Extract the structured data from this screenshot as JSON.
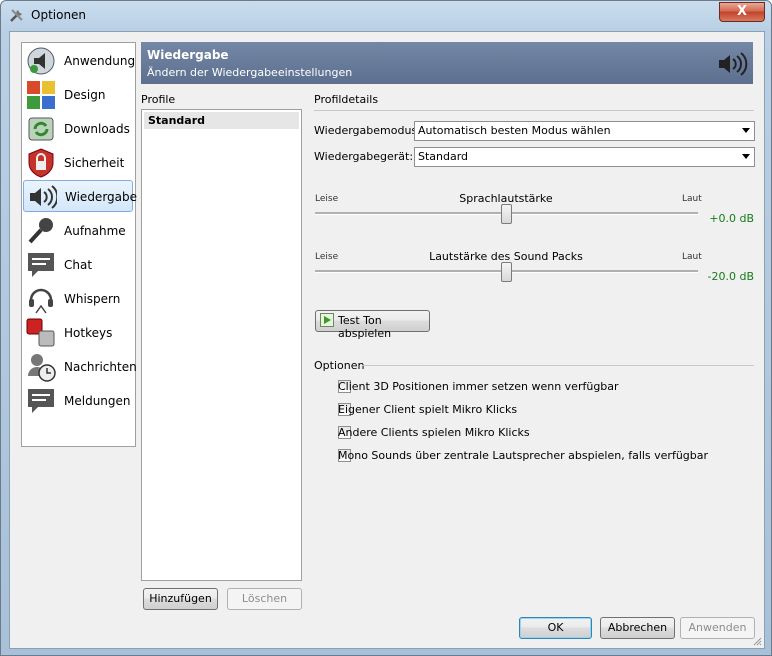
{
  "window": {
    "title": "Optionen",
    "close_label": "X"
  },
  "sidebar": {
    "items": [
      {
        "label": "Anwendung",
        "icon": "speaker-app-icon"
      },
      {
        "label": "Design",
        "icon": "design-tiles-icon"
      },
      {
        "label": "Downloads",
        "icon": "downloads-icon"
      },
      {
        "label": "Sicherheit",
        "icon": "shield-lock-icon"
      },
      {
        "label": "Wiedergabe",
        "icon": "speaker-waves-icon",
        "selected": true
      },
      {
        "label": "Aufnahme",
        "icon": "microphone-icon"
      },
      {
        "label": "Chat",
        "icon": "chat-icon"
      },
      {
        "label": "Whispern",
        "icon": "headset-icon"
      },
      {
        "label": "Hotkeys",
        "icon": "hotkeys-icon"
      },
      {
        "label": "Nachrichten",
        "icon": "messages-icon"
      },
      {
        "label": "Meldungen",
        "icon": "notifications-icon"
      }
    ]
  },
  "header": {
    "title": "Wiedergabe",
    "subtitle": "Ändern der Wiedergabeeinstellungen"
  },
  "profiles": {
    "label": "Profile",
    "items": [
      "Standard"
    ],
    "add_label": "Hinzufügen",
    "delete_label": "Löschen"
  },
  "details": {
    "label": "Profildetails",
    "mode_label": "Wiedergabemodus:",
    "mode_value": "Automatisch besten Modus wählen",
    "device_label": "Wiedergabegerät:",
    "device_value": "Standard",
    "voice_slider": {
      "title": "Sprachlautstärke",
      "min_label": "Leise",
      "max_label": "Laut",
      "value_text": "+0.0 dB",
      "position": 0.5
    },
    "sound_slider": {
      "title": "Lautstärke des Sound Packs",
      "min_label": "Leise",
      "max_label": "Laut",
      "value_text": "-20.0 dB",
      "position": 0.5
    },
    "test_button": "Test Ton abspielen"
  },
  "options": {
    "label": "Optionen",
    "checkboxes": [
      {
        "label": "Client 3D Positionen immer setzen wenn verfügbar",
        "checked": false
      },
      {
        "label": "Eigener Client spielt Mikro Klicks",
        "checked": false
      },
      {
        "label": "Andere Clients spielen Mikro Klicks",
        "checked": false
      },
      {
        "label": "Mono Sounds über zentrale Lautsprecher abspielen, falls verfügbar",
        "checked": false
      }
    ]
  },
  "footer": {
    "ok": "OK",
    "cancel": "Abbrechen",
    "apply": "Anwenden"
  },
  "colors": {
    "header_bg": "#6a7c9a",
    "selection_border": "#84acdd",
    "db_green": "#197a19"
  }
}
